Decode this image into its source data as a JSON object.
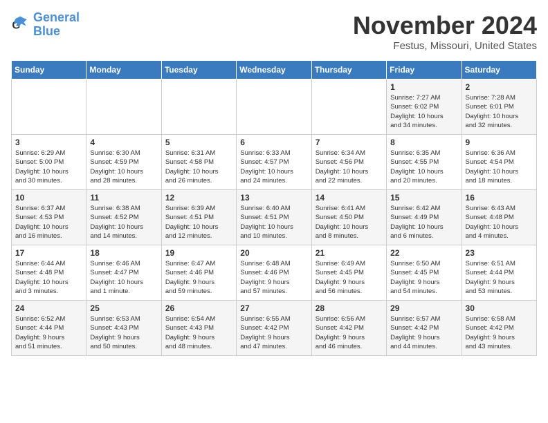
{
  "logo": {
    "line1": "General",
    "line2": "Blue"
  },
  "title": "November 2024",
  "location": "Festus, Missouri, United States",
  "weekdays": [
    "Sunday",
    "Monday",
    "Tuesday",
    "Wednesday",
    "Thursday",
    "Friday",
    "Saturday"
  ],
  "weeks": [
    [
      {
        "day": "",
        "info": ""
      },
      {
        "day": "",
        "info": ""
      },
      {
        "day": "",
        "info": ""
      },
      {
        "day": "",
        "info": ""
      },
      {
        "day": "",
        "info": ""
      },
      {
        "day": "1",
        "info": "Sunrise: 7:27 AM\nSunset: 6:02 PM\nDaylight: 10 hours\nand 34 minutes."
      },
      {
        "day": "2",
        "info": "Sunrise: 7:28 AM\nSunset: 6:01 PM\nDaylight: 10 hours\nand 32 minutes."
      }
    ],
    [
      {
        "day": "3",
        "info": "Sunrise: 6:29 AM\nSunset: 5:00 PM\nDaylight: 10 hours\nand 30 minutes."
      },
      {
        "day": "4",
        "info": "Sunrise: 6:30 AM\nSunset: 4:59 PM\nDaylight: 10 hours\nand 28 minutes."
      },
      {
        "day": "5",
        "info": "Sunrise: 6:31 AM\nSunset: 4:58 PM\nDaylight: 10 hours\nand 26 minutes."
      },
      {
        "day": "6",
        "info": "Sunrise: 6:33 AM\nSunset: 4:57 PM\nDaylight: 10 hours\nand 24 minutes."
      },
      {
        "day": "7",
        "info": "Sunrise: 6:34 AM\nSunset: 4:56 PM\nDaylight: 10 hours\nand 22 minutes."
      },
      {
        "day": "8",
        "info": "Sunrise: 6:35 AM\nSunset: 4:55 PM\nDaylight: 10 hours\nand 20 minutes."
      },
      {
        "day": "9",
        "info": "Sunrise: 6:36 AM\nSunset: 4:54 PM\nDaylight: 10 hours\nand 18 minutes."
      }
    ],
    [
      {
        "day": "10",
        "info": "Sunrise: 6:37 AM\nSunset: 4:53 PM\nDaylight: 10 hours\nand 16 minutes."
      },
      {
        "day": "11",
        "info": "Sunrise: 6:38 AM\nSunset: 4:52 PM\nDaylight: 10 hours\nand 14 minutes."
      },
      {
        "day": "12",
        "info": "Sunrise: 6:39 AM\nSunset: 4:51 PM\nDaylight: 10 hours\nand 12 minutes."
      },
      {
        "day": "13",
        "info": "Sunrise: 6:40 AM\nSunset: 4:51 PM\nDaylight: 10 hours\nand 10 minutes."
      },
      {
        "day": "14",
        "info": "Sunrise: 6:41 AM\nSunset: 4:50 PM\nDaylight: 10 hours\nand 8 minutes."
      },
      {
        "day": "15",
        "info": "Sunrise: 6:42 AM\nSunset: 4:49 PM\nDaylight: 10 hours\nand 6 minutes."
      },
      {
        "day": "16",
        "info": "Sunrise: 6:43 AM\nSunset: 4:48 PM\nDaylight: 10 hours\nand 4 minutes."
      }
    ],
    [
      {
        "day": "17",
        "info": "Sunrise: 6:44 AM\nSunset: 4:48 PM\nDaylight: 10 hours\nand 3 minutes."
      },
      {
        "day": "18",
        "info": "Sunrise: 6:46 AM\nSunset: 4:47 PM\nDaylight: 10 hours\nand 1 minute."
      },
      {
        "day": "19",
        "info": "Sunrise: 6:47 AM\nSunset: 4:46 PM\nDaylight: 9 hours\nand 59 minutes."
      },
      {
        "day": "20",
        "info": "Sunrise: 6:48 AM\nSunset: 4:46 PM\nDaylight: 9 hours\nand 57 minutes."
      },
      {
        "day": "21",
        "info": "Sunrise: 6:49 AM\nSunset: 4:45 PM\nDaylight: 9 hours\nand 56 minutes."
      },
      {
        "day": "22",
        "info": "Sunrise: 6:50 AM\nSunset: 4:45 PM\nDaylight: 9 hours\nand 54 minutes."
      },
      {
        "day": "23",
        "info": "Sunrise: 6:51 AM\nSunset: 4:44 PM\nDaylight: 9 hours\nand 53 minutes."
      }
    ],
    [
      {
        "day": "24",
        "info": "Sunrise: 6:52 AM\nSunset: 4:44 PM\nDaylight: 9 hours\nand 51 minutes."
      },
      {
        "day": "25",
        "info": "Sunrise: 6:53 AM\nSunset: 4:43 PM\nDaylight: 9 hours\nand 50 minutes."
      },
      {
        "day": "26",
        "info": "Sunrise: 6:54 AM\nSunset: 4:43 PM\nDaylight: 9 hours\nand 48 minutes."
      },
      {
        "day": "27",
        "info": "Sunrise: 6:55 AM\nSunset: 4:42 PM\nDaylight: 9 hours\nand 47 minutes."
      },
      {
        "day": "28",
        "info": "Sunrise: 6:56 AM\nSunset: 4:42 PM\nDaylight: 9 hours\nand 46 minutes."
      },
      {
        "day": "29",
        "info": "Sunrise: 6:57 AM\nSunset: 4:42 PM\nDaylight: 9 hours\nand 44 minutes."
      },
      {
        "day": "30",
        "info": "Sunrise: 6:58 AM\nSunset: 4:42 PM\nDaylight: 9 hours\nand 43 minutes."
      }
    ]
  ]
}
